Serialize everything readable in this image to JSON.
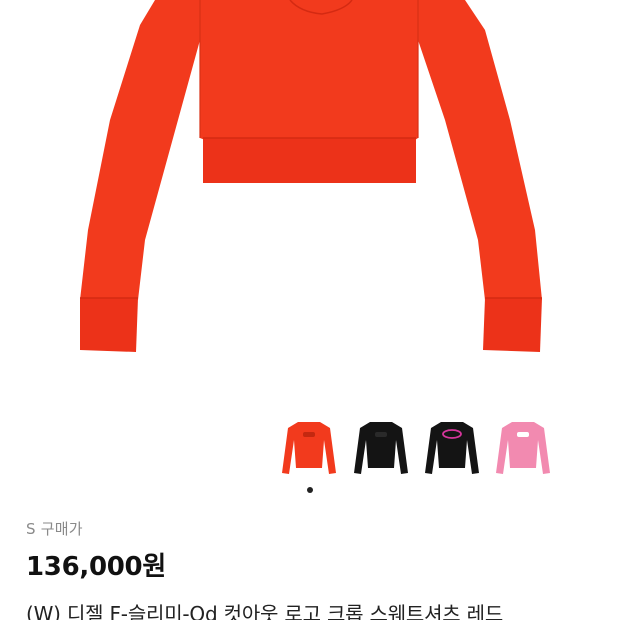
{
  "main_image": {
    "color": "#f23a1d",
    "description_icon": "sweatshirt-image"
  },
  "thumbnails": [
    {
      "name": "thumbnail-red",
      "color": "#f23a1d",
      "logo_color": "#c42810"
    },
    {
      "name": "thumbnail-black",
      "color": "#141414",
      "logo_color": "#2a2a2a"
    },
    {
      "name": "thumbnail-black-pink-logo",
      "color": "#141414",
      "logo_color": "#d6359b"
    },
    {
      "name": "thumbnail-pink",
      "color": "#f28ab0",
      "logo_color": "#ffffff"
    }
  ],
  "product": {
    "size_label": "S 구매가",
    "price": "136,000원",
    "name": "(W) 디젤 F-슬리미-Od 컷아웃 로고 크롭 스웨트셔츠 레드"
  }
}
